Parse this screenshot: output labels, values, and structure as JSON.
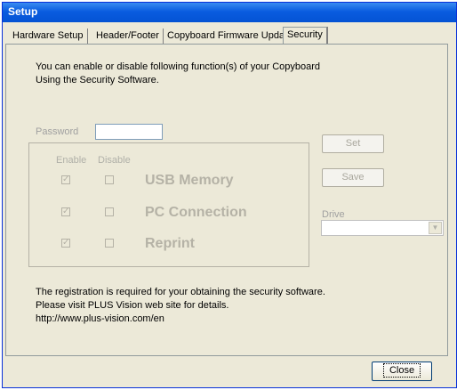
{
  "window": {
    "title": "Setup"
  },
  "tabs": [
    {
      "label": "Hardware Setup"
    },
    {
      "label": "Header/Footer"
    },
    {
      "label": "Copyboard Firmware Update"
    },
    {
      "label": "Security"
    }
  ],
  "intro": {
    "line1": "You can enable or disable following function(s) of your Copyboard",
    "line2": "Using the Security Software."
  },
  "password": {
    "label": "Password",
    "value": ""
  },
  "functions": {
    "enable_header": "Enable",
    "disable_header": "Disable",
    "items": [
      {
        "label": "USB Memory",
        "enabled": true,
        "disabled": false
      },
      {
        "label": "PC Connection",
        "enabled": true,
        "disabled": false
      },
      {
        "label": "Reprint",
        "enabled": true,
        "disabled": false
      }
    ]
  },
  "buttons": {
    "set": "Set",
    "save": "Save",
    "close": "Close"
  },
  "drive": {
    "label": "Drive",
    "value": ""
  },
  "registration": {
    "line1": "The registration is required for your obtaining the security software.",
    "line2": "Please visit PLUS Vision web site for details.",
    "line3": "http://www.plus-vision.com/en"
  }
}
